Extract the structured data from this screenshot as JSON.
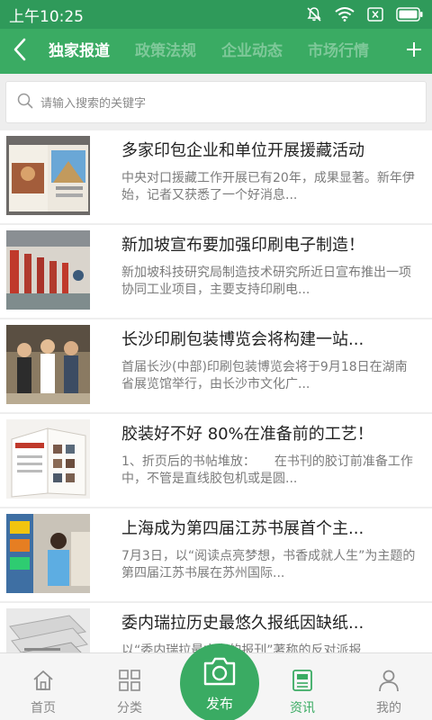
{
  "status_bar": {
    "time": "上午10:25",
    "icons": [
      "mute-icon",
      "wifi-icon",
      "close-box-icon",
      "battery-icon"
    ]
  },
  "header": {
    "tabs": [
      {
        "label": "独家报道",
        "active": true
      },
      {
        "label": "政策法规",
        "active": false
      },
      {
        "label": "企业动态",
        "active": false
      },
      {
        "label": "市场行情",
        "active": false
      }
    ],
    "back_icon": "chevron-left-icon",
    "add_icon": "plus-icon"
  },
  "search": {
    "placeholder": "请输入搜索的关键字",
    "icon": "search-icon"
  },
  "news": [
    {
      "title": "多家印包企业和单位开展援藏活动",
      "summary": "中央对口援藏工作开展已有20年，成果显著。新年伊始，记者又获悉了一个好消息..."
    },
    {
      "title": "新加坡宣布要加强印刷电子制造！",
      "summary": "新加坡科技研究局制造技术研究所近日宣布推出一项协同工业项目，主要支持印刷电..."
    },
    {
      "title": "长沙印刷包装博览会将构建一站...",
      "summary": "首届长沙(中部)印刷包装博览会将于9月18日在湖南省展览馆举行，由长沙市文化广..."
    },
    {
      "title": "胶装好不好 80%在准备前的工艺！",
      "summary": "1、折页后的书帖堆放：　　在书刊的胶订前准备工作中，不管是直线胶包机或是圆..."
    },
    {
      "title": "上海成为第四届江苏书展首个主...",
      "summary": "7月3日，以“阅读点亮梦想，书香成就人生”为主题的第四届江苏书展在苏州国际..."
    },
    {
      "title": "委内瑞拉历史最悠久报纸因缺纸...",
      "summary": "以“委内瑞拉最古老的报刊”著称的反对派报"
    }
  ],
  "bottom_nav": {
    "items": [
      {
        "label": "首页",
        "icon": "home-icon",
        "active": false
      },
      {
        "label": "分类",
        "icon": "grid-icon",
        "active": false
      },
      {
        "label": "资讯",
        "icon": "news-icon",
        "active": true
      },
      {
        "label": "我的",
        "icon": "user-icon",
        "active": false
      }
    ],
    "publish": {
      "label": "发布",
      "icon": "camera-icon"
    }
  },
  "colors": {
    "primary": "#3aab63",
    "status_bar": "#2f9a5a"
  }
}
